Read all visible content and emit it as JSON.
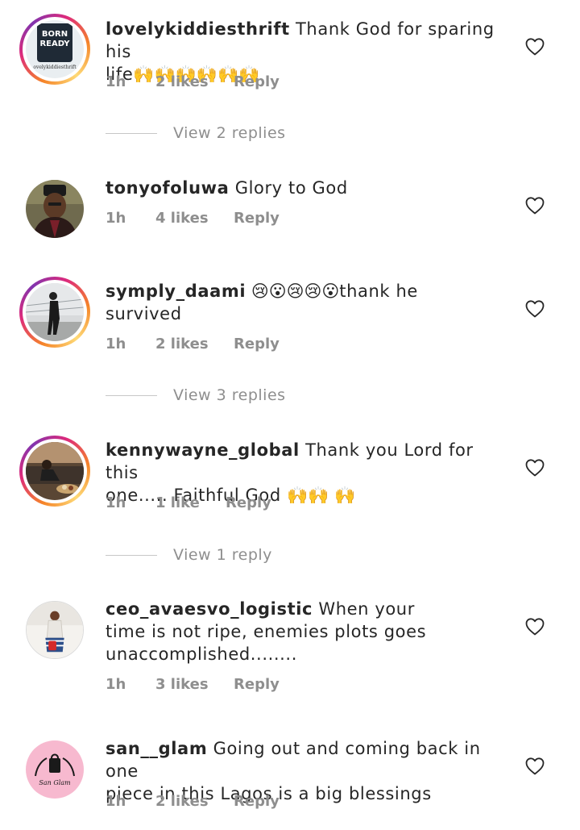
{
  "comments": [
    {
      "username": "lovelykiddiesthrift",
      "text_line1": " Thank God for sparing his",
      "text_line2": "life",
      "emojis": "🙌🙌🙌🙌🙌🙌",
      "time": "1h",
      "likes": "2 likes",
      "reply": "Reply",
      "view_replies": "View 2 replies",
      "avatar_text1": "BORN",
      "avatar_text2": "READY",
      "avatar_text3": "ovelykiddiesthrift"
    },
    {
      "username": "tonyofoluwa",
      "text_line1": " Glory to God",
      "time": "1h",
      "likes": "4 likes",
      "reply": "Reply"
    },
    {
      "username": "symply_daami",
      "emojis": " 😢😮😢😢😮",
      "text_line1": "thank he",
      "text_line2": "survived",
      "time": "1h",
      "likes": "2 likes",
      "reply": "Reply",
      "view_replies": "View 3 replies"
    },
    {
      "username": "kennywayne_global",
      "text_line1": " Thank you Lord for this",
      "text_line2": "one..... Faithful God ",
      "emojis": "🙌🙌 🙌",
      "time": "1h",
      "likes": "1 like",
      "reply": "Reply",
      "view_replies": "View 1 reply"
    },
    {
      "username": "ceo_avaesvo_logistic",
      "text_line1": " When your",
      "text_line2": "time is not ripe, enemies plots goes",
      "text_line3": "unaccomplished........",
      "time": "1h",
      "likes": "3 likes",
      "reply": "Reply"
    },
    {
      "username": "san__glam",
      "text_line1": " Going out and coming back in one",
      "text_line2": "piece in this Lagos is a big blessings",
      "time": "1h",
      "likes": "2 likes",
      "reply": "Reply",
      "avatar_text1": "San Glam"
    }
  ],
  "icons": {
    "like": "heart-outline-icon"
  },
  "colors": {
    "text": "#262626",
    "muted": "#8e8e8e",
    "pink_avatar": "#f7b9cf"
  }
}
